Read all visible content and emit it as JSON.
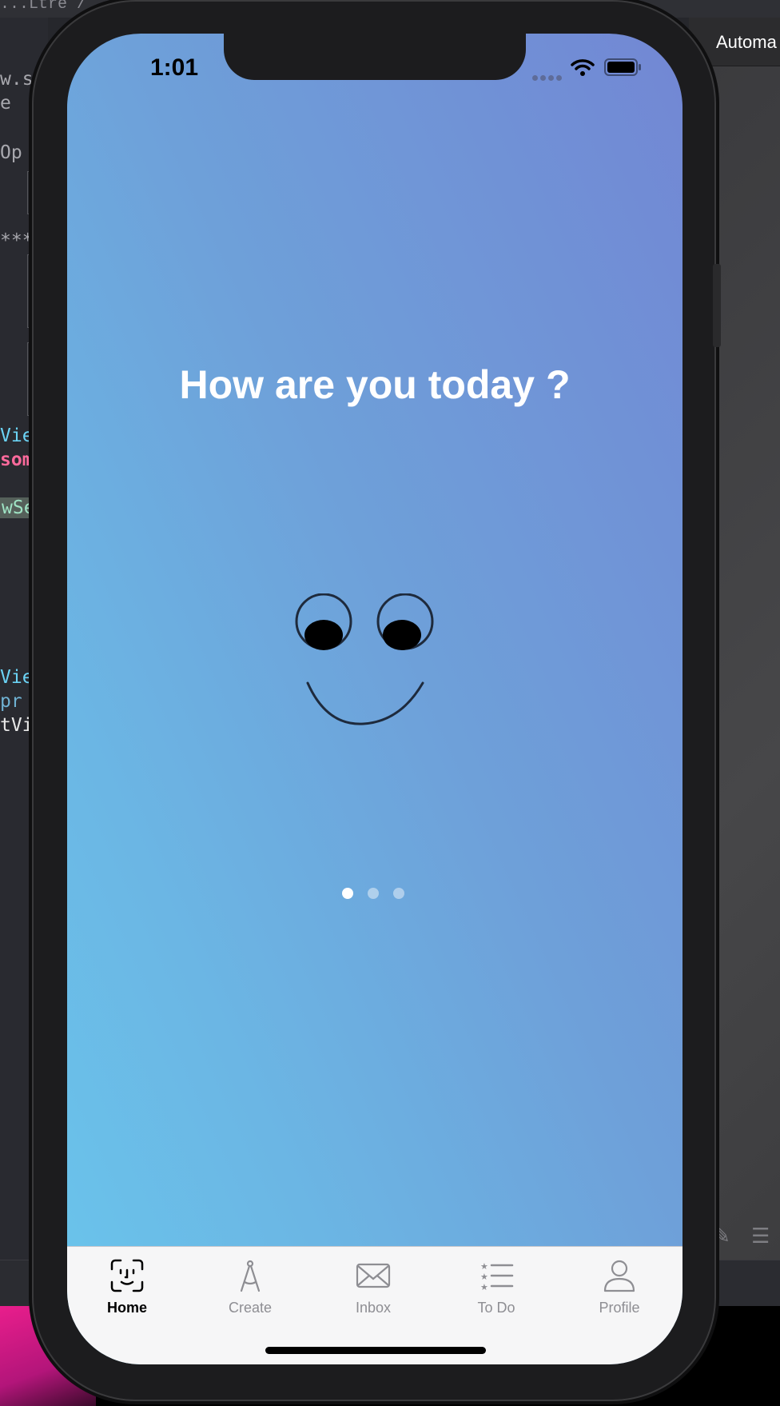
{
  "editor": {
    "breadcrumb": "...Ltre / ... ContentView.swift / ...",
    "lines": [
      {
        "text": "w.sw",
        "color": "grey"
      },
      {
        "text": "e",
        "color": "grey"
      },
      {
        "text": " Op",
        "color": "grey"
      },
      {
        "text": "****",
        "color": "grey"
      },
      {
        "text": "Vie",
        "color": "teal"
      },
      {
        "text": "som",
        "color": "pink"
      },
      {
        "text": "wSe",
        "color": "green"
      },
      {
        "text": "Vie",
        "color": "teal"
      },
      {
        "text": " pr",
        "color": "blue"
      },
      {
        "text": "tVi",
        "color": "white"
      }
    ]
  },
  "inspector": {
    "title": "Automa"
  },
  "phone": {
    "status": {
      "time": "1:01"
    },
    "main": {
      "question": "How are you today ?",
      "page_indicator": {
        "count": 3,
        "current": 1
      }
    },
    "tabbar": {
      "tabs": [
        {
          "label": "Home",
          "icon": "face-id-icon",
          "active": true
        },
        {
          "label": "Create",
          "icon": "compass-icon",
          "active": false
        },
        {
          "label": "Inbox",
          "icon": "envelope-icon",
          "active": false
        },
        {
          "label": "To Do",
          "icon": "checklist-icon",
          "active": false
        },
        {
          "label": "Profile",
          "icon": "person-icon",
          "active": false
        }
      ]
    }
  }
}
